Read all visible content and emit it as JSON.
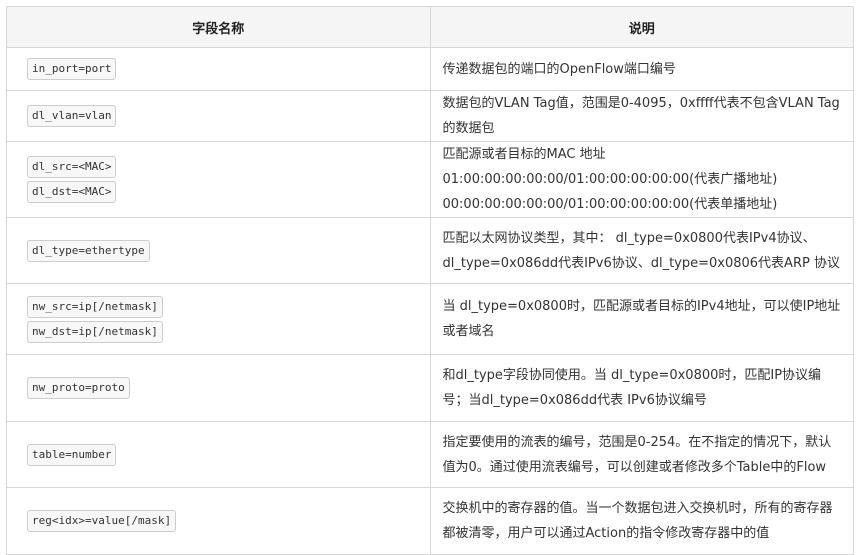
{
  "header": {
    "col_name": "字段名称",
    "col_desc": "说明"
  },
  "rows": [
    {
      "fields": [
        "in_port=port"
      ],
      "desc": "传递数据包的端口的OpenFlow端口编号"
    },
    {
      "fields": [
        "dl_vlan=vlan"
      ],
      "desc": "数据包的VLAN Tag值，范围是0-4095，0xffff代表不包含VLAN Tag的数据包"
    },
    {
      "fields": [
        "dl_src=<MAC>",
        "dl_dst=<MAC>"
      ],
      "desc": "匹配源或者目标的MAC 地址 01:00:00:00:00:00/01:00:00:00:00:00(代表广播地址) 00:00:00:00:00:00/01:00:00:00:00:00(代表单播地址)"
    },
    {
      "fields": [
        "dl_type=ethertype"
      ],
      "desc": "匹配以太网协议类型，其中： dl_type=0x0800代表IPv4协议、dl_type=0x086dd代表IPv6协议、dl_type=0x0806代表ARP 协议"
    },
    {
      "fields": [
        "nw_src=ip[/netmask]",
        "nw_dst=ip[/netmask]"
      ],
      "desc": "当 dl_type=0x0800时，匹配源或者目标的IPv4地址，可以使IP地址或者域名"
    },
    {
      "fields": [
        "nw_proto=proto"
      ],
      "desc": "和dl_type字段协同使用。当 dl_type=0x0800时，匹配IP协议编号；当dl_type=0x086dd代表 IPv6协议编号"
    },
    {
      "fields": [
        "table=number"
      ],
      "desc": "指定要使用的流表的编号，范围是0-254。在不指定的情况下，默认值为0。通过使用流表编号，可以创建或者修改多个Table中的Flow"
    },
    {
      "fields": [
        "reg<idx>=value[/mask]"
      ],
      "desc": "交换机中的寄存器的值。当一个数据包进入交换机时，所有的寄存器都被清零，用户可以通过Action的指令修改寄存器中的值"
    }
  ]
}
